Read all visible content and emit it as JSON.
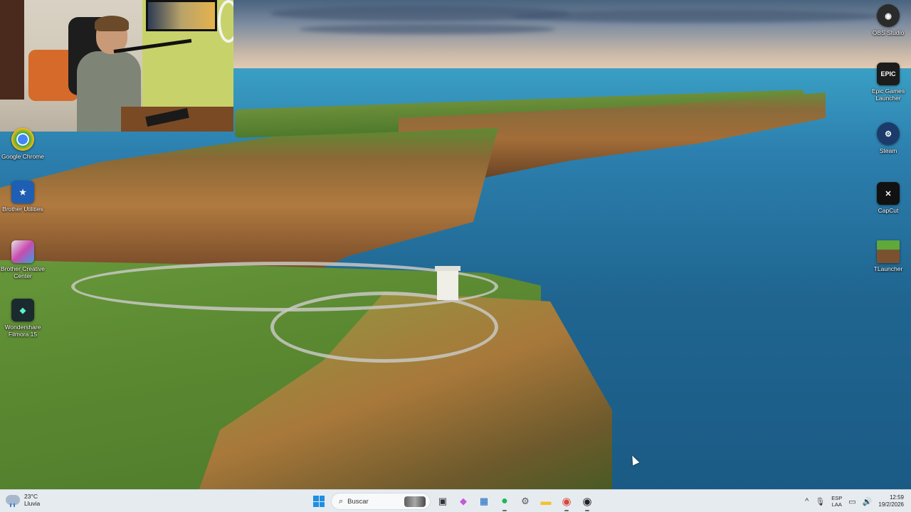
{
  "desktop": {
    "left_icons": [
      {
        "label": "Google Chrome",
        "icon": "chrome-icon",
        "color": "#db4437"
      },
      {
        "label": "Brother Utilities",
        "icon": "brother-utilities-icon",
        "color": "#1e5fb4"
      },
      {
        "label": "Brother Creative Center",
        "icon": "brother-creative-center-icon",
        "color": "#c84bb0"
      },
      {
        "label": "Wondershare Filmora 15",
        "icon": "filmora-icon",
        "color": "#1a2a2e"
      }
    ],
    "right_icons": [
      {
        "label": "OBS Studio",
        "icon": "obs-icon",
        "color": "#2b2b2b"
      },
      {
        "label": "Epic Games Launcher",
        "icon": "epic-games-icon",
        "color": "#1c1c1c",
        "badge": "EPIC"
      },
      {
        "label": "Steam",
        "icon": "steam-icon",
        "color": "#1b3c6b"
      },
      {
        "label": "CapCut",
        "icon": "capcut-icon",
        "color": "#111111"
      },
      {
        "label": "TLauncher",
        "icon": "tlauncher-icon",
        "color": "#4f8a2b"
      }
    ]
  },
  "taskbar": {
    "weather": {
      "temp": "23°C",
      "condition": "Lluvia"
    },
    "search_placeholder": "Buscar",
    "apps": [
      {
        "name": "start",
        "icon": "windows-icon"
      },
      {
        "name": "search"
      },
      {
        "name": "task-view",
        "icon": "task-view-icon",
        "glyph": "▣"
      },
      {
        "name": "copilot",
        "icon": "copilot-icon",
        "glyph": "◆"
      },
      {
        "name": "store",
        "icon": "store-icon",
        "glyph": "▦"
      },
      {
        "name": "spotify",
        "icon": "spotify-icon",
        "glyph": "●"
      },
      {
        "name": "settings",
        "icon": "settings-icon",
        "glyph": "⚙"
      },
      {
        "name": "file-explorer",
        "icon": "folder-icon",
        "glyph": "▬"
      },
      {
        "name": "chrome",
        "icon": "chrome-icon",
        "glyph": "◉"
      },
      {
        "name": "obs",
        "icon": "obs-icon",
        "glyph": "◉"
      }
    ],
    "tray": {
      "chevron": "^",
      "mic": "🎙",
      "lang_top": "ESP",
      "lang_bottom": "LAA",
      "network": "▭",
      "volume": "🔊",
      "time": "12:59",
      "date": "19/2/2026"
    }
  }
}
